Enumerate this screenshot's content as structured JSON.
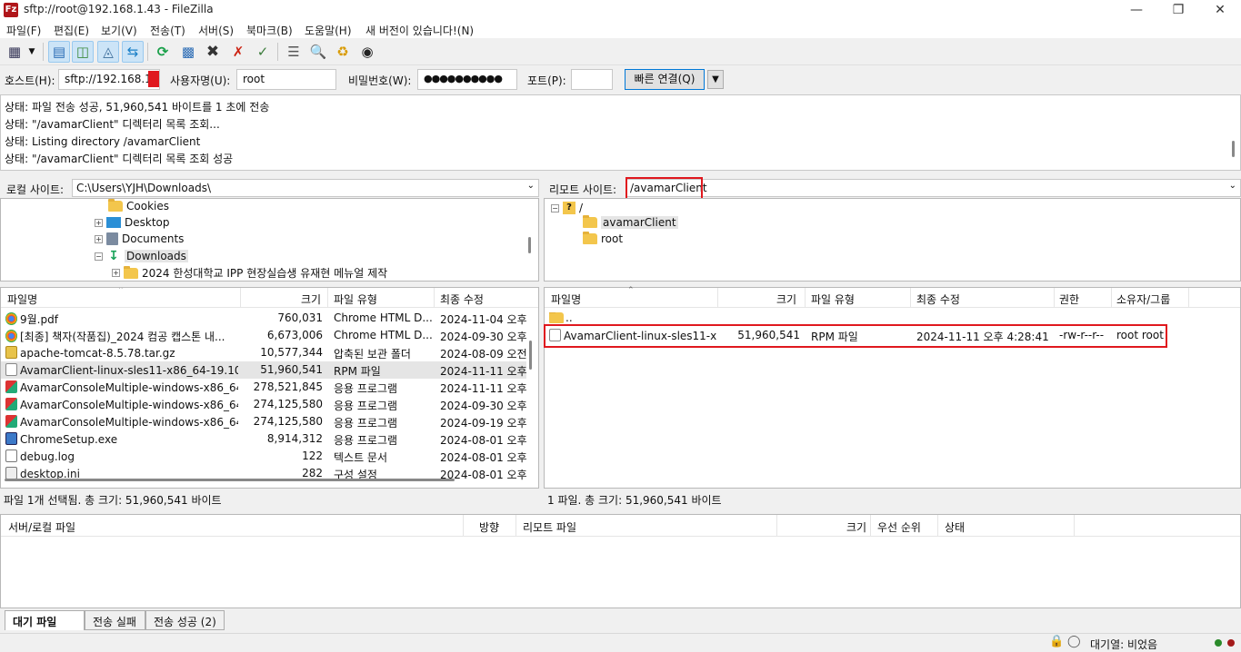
{
  "window": {
    "title": "sftp://root@192.168.1.43 - FileZilla",
    "app_icon": "Fz"
  },
  "menu": [
    "파일(F)",
    "편집(E)",
    "보기(V)",
    "전송(T)",
    "서버(S)",
    "북마크(B)",
    "도움말(H)",
    "새 버전이 있습니다!(N)"
  ],
  "quickconnect": {
    "host_label": "호스트(H):",
    "host_value": "sftp://192.168.1.",
    "user_label": "사용자명(U):",
    "user_value": "root",
    "pass_label": "비밀번호(W):",
    "pass_value": "●●●●●●●●●●",
    "port_label": "포트(P):",
    "port_value": "",
    "connect_button": "빠른 연결(Q)",
    "dropdown": "▼"
  },
  "log": [
    "상태:  파일 전송 성공, 51,960,541 바이트를 1 초에 전송",
    "상태:  \"/avamarClient\" 디렉터리 목록 조회...",
    "상태:  Listing directory /avamarClient",
    "상태:  \"/avamarClient\" 디렉터리 목록 조회 성공"
  ],
  "local": {
    "site_label": "로컬 사이트:",
    "path": "C:\\Users\\YJH\\Downloads\\",
    "tree": [
      "Cookies",
      "Desktop",
      "Documents",
      "Downloads",
      "2024 한성대학교 IPP 현장실습생 유재현 메뉴얼 제작"
    ],
    "columns": [
      "파일명",
      "크기",
      "파일 유형",
      "최종 수정"
    ],
    "files": [
      {
        "name": "9월.pdf",
        "size": "760,031",
        "type": "Chrome HTML D...",
        "modified": "2024-11-04 오후",
        "icon": "chrome-icon"
      },
      {
        "name": "[최종] 책자(작품집)_2024 컴공 캡스톤 내...",
        "size": "6,673,006",
        "type": "Chrome HTML D...",
        "modified": "2024-09-30 오후",
        "icon": "chrome-icon"
      },
      {
        "name": "apache-tomcat-8.5.78.tar.gz",
        "size": "10,577,344",
        "type": "압축된 보관 폴더",
        "modified": "2024-08-09 오전",
        "icon": "archive-icon"
      },
      {
        "name": "AvamarClient-linux-sles11-x86_64-19.10....",
        "size": "51,960,541",
        "type": "RPM 파일",
        "modified": "2024-11-11 오후",
        "icon": "file-icon"
      },
      {
        "name": "AvamarConsoleMultiple-windows-x86_64-...",
        "size": "278,521,845",
        "type": "응용 프로그램",
        "modified": "2024-11-11 오후",
        "icon": "app-icon"
      },
      {
        "name": "AvamarConsoleMultiple-windows-x86_64-...",
        "size": "274,125,580",
        "type": "응용 프로그램",
        "modified": "2024-09-30 오후",
        "icon": "app-icon"
      },
      {
        "name": "AvamarConsoleMultiple-windows-x86_64-...",
        "size": "274,125,580",
        "type": "응용 프로그램",
        "modified": "2024-09-19 오후",
        "icon": "app-icon"
      },
      {
        "name": "ChromeSetup.exe",
        "size": "8,914,312",
        "type": "응용 프로그램",
        "modified": "2024-08-01 오후",
        "icon": "setup-icon"
      },
      {
        "name": "debug.log",
        "size": "122",
        "type": "텍스트 문서",
        "modified": "2024-08-01 오후",
        "icon": "text-icon"
      },
      {
        "name": "desktop.ini",
        "size": "282",
        "type": "구성 설정",
        "modified": "2024-08-01 오후",
        "icon": "ini-icon"
      }
    ],
    "status": "파일 1개 선택됨. 총 크기: 51,960,541 바이트"
  },
  "remote": {
    "site_label": "리모트 사이트:",
    "path": "/avamarClient",
    "tree": [
      "/",
      "avamarClient",
      "root"
    ],
    "columns": [
      "파일명",
      "크기",
      "파일 유형",
      "최종 수정",
      "권한",
      "소유자/그룹"
    ],
    "parent": "..",
    "files": [
      {
        "name": "AvamarClient-linux-sles11-x...",
        "size": "51,960,541",
        "type": "RPM 파일",
        "modified": "2024-11-11 오후 4:28:41",
        "perm": "-rw-r--r--",
        "owner": "root root"
      }
    ],
    "status": "1 파일. 총 크기: 51,960,541 바이트"
  },
  "queue": {
    "columns": [
      "서버/로컬 파일",
      "방향",
      "리모트 파일",
      "크기",
      "우선 순위",
      "상태"
    ],
    "tabs": [
      "대기 파일",
      "전송 실패",
      "전송 성공 (2)"
    ]
  },
  "bottom_status": "대기열: 비었음",
  "colors": {
    "highlight": "#e0181e",
    "folder": "#f3c64c",
    "accent": "#0078d7"
  }
}
